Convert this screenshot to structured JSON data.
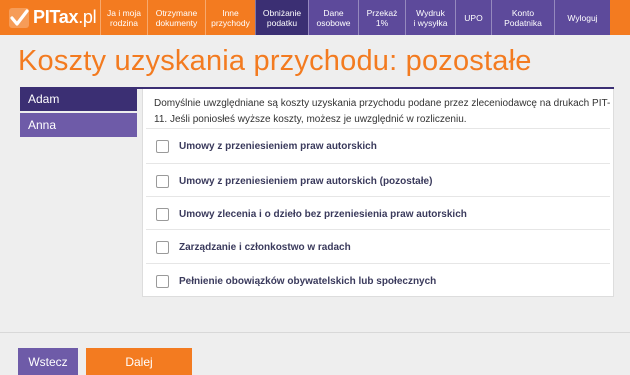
{
  "brand": {
    "name_main": "PITax",
    "name_suffix": ".pl",
    "accent": "#f37b20",
    "dark": "#3b2f73",
    "purple": "#6e5ba8"
  },
  "nav": [
    {
      "label": "Ja i moja\nrodzina"
    },
    {
      "label": "Otrzymane\ndokumenty"
    },
    {
      "label": "Inne\nprzychody"
    },
    {
      "label": "Obniżanie\npodatku"
    },
    {
      "label": "Dane\nosobowe"
    },
    {
      "label": "Przekaż\n1%"
    },
    {
      "label": "Wydruk\ni wysyłka"
    },
    {
      "label": "UPO"
    },
    {
      "label": "Konto\nPodatnika"
    },
    {
      "label": "Wyloguj"
    }
  ],
  "page": {
    "title": "Koszty uzyskania przychodu: pozostałe"
  },
  "persons": [
    {
      "label": "Adam"
    },
    {
      "label": "Anna"
    }
  ],
  "intro": "Domyślnie uwzględniane są koszty uzyskania przychodu podane przez zleceniodawcę na drukach PIT-11. Jeśli poniosłeś wyższe koszty, możesz je uwzględnić w rozliczeniu.",
  "options": [
    {
      "label": "Umowy z przeniesieniem praw autorskich",
      "checked": false
    },
    {
      "label": "Umowy z przeniesieniem praw autorskich (pozostałe)",
      "checked": false
    },
    {
      "label": "Umowy zlecenia i o dzieło bez przeniesienia praw autorskich",
      "checked": false
    },
    {
      "label": "Zarządzanie i członkostwo w radach",
      "checked": false
    },
    {
      "label": "Pełnienie obowiązków obywatelskich lub społecznych",
      "checked": false
    }
  ],
  "footer": {
    "back_label": "Wstecz",
    "next_label": "Dalej"
  }
}
